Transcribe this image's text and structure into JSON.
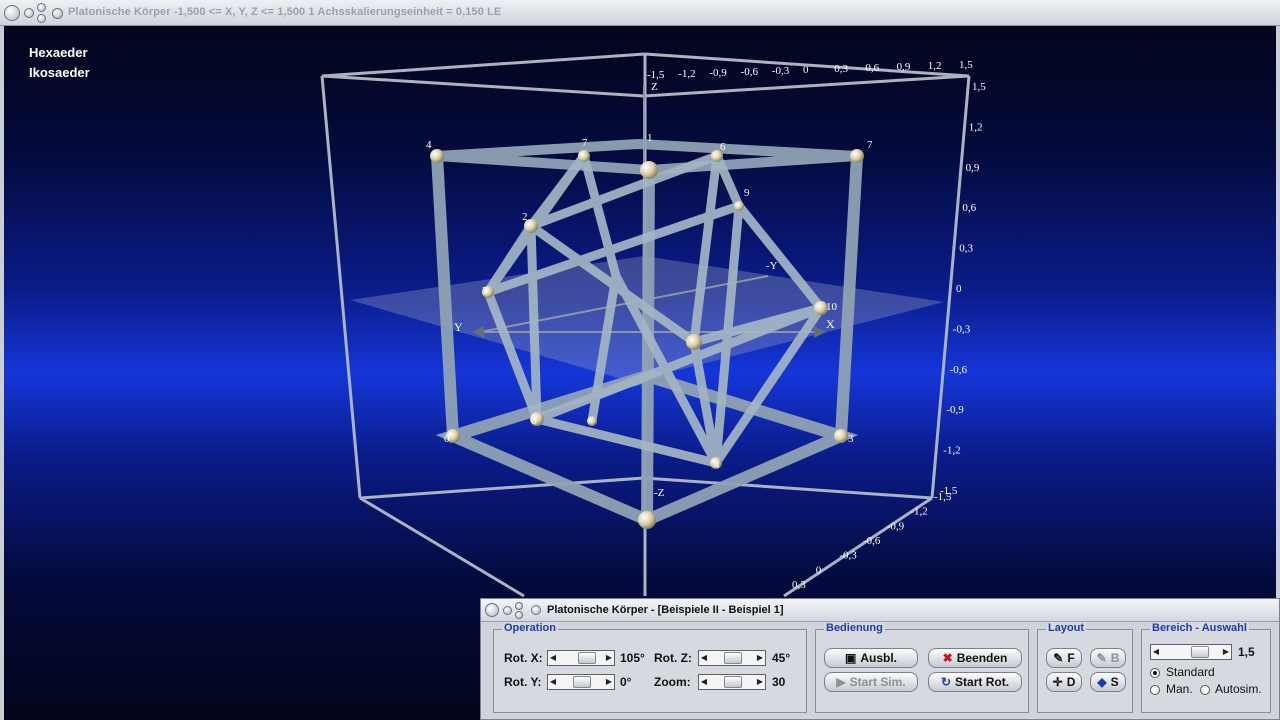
{
  "main_window": {
    "title": "Platonische Körper   -1,500 <= X, Y, Z <= 1,500    1 Achsskalierungseinheit = 0,150 LE"
  },
  "scene": {
    "legend": [
      "Hexaeder",
      "Ikosaeder"
    ],
    "axis_labels": {
      "x": "X",
      "neg_y": "-Y",
      "y": "Y",
      "z": "Z",
      "neg_z": "-Z"
    },
    "top_ticks": [
      "-1,5",
      "-1,2",
      "-0,9",
      "-0,6",
      "-0,3",
      "0",
      "0,3",
      "0,6",
      "0,9",
      "1,2",
      "1,5"
    ],
    "right_ticks": [
      "1,5",
      "1,2",
      "0,9",
      "0,6",
      "0,3",
      "0",
      "-0,3",
      "-0,6",
      "-0,9",
      "-1,2",
      "-1,5"
    ],
    "bottom_ticks": [
      "-1,5",
      "-1,2",
      "-0,9",
      "-0,6",
      "-0,3",
      "0",
      "0,3"
    ],
    "hexaeder_vertex_labels": [
      "0",
      "3",
      "4",
      "7",
      "6",
      "7"
    ],
    "ikosaeder_vertex_labels": [
      "2",
      "3",
      "9",
      "10",
      "4",
      "1",
      "6"
    ]
  },
  "dialog": {
    "title": "Platonische Körper - [Beispiele II - Beispiel 1]",
    "operation": {
      "title": "Operation",
      "rot_x_label": "Rot. X:",
      "rot_x_value": "105°",
      "rot_y_label": "Rot. Y:",
      "rot_y_value": "0°",
      "rot_z_label": "Rot. Z:",
      "rot_z_value": "45°",
      "zoom_label": "Zoom:",
      "zoom_value": "30"
    },
    "bedienung": {
      "title": "Bedienung",
      "ausbl": "Ausbl.",
      "beenden": "Beenden",
      "start_sim": "Start Sim.",
      "start_rot": "Start Rot."
    },
    "layout": {
      "title": "Layout",
      "f": "F",
      "b": "B",
      "d": "D",
      "s": "S"
    },
    "bereich": {
      "title": "Bereich - Auswahl",
      "value": "1,5",
      "standard": "Standard",
      "man": "Man.",
      "autosim": "Autosim.",
      "selected": "Standard"
    }
  }
}
